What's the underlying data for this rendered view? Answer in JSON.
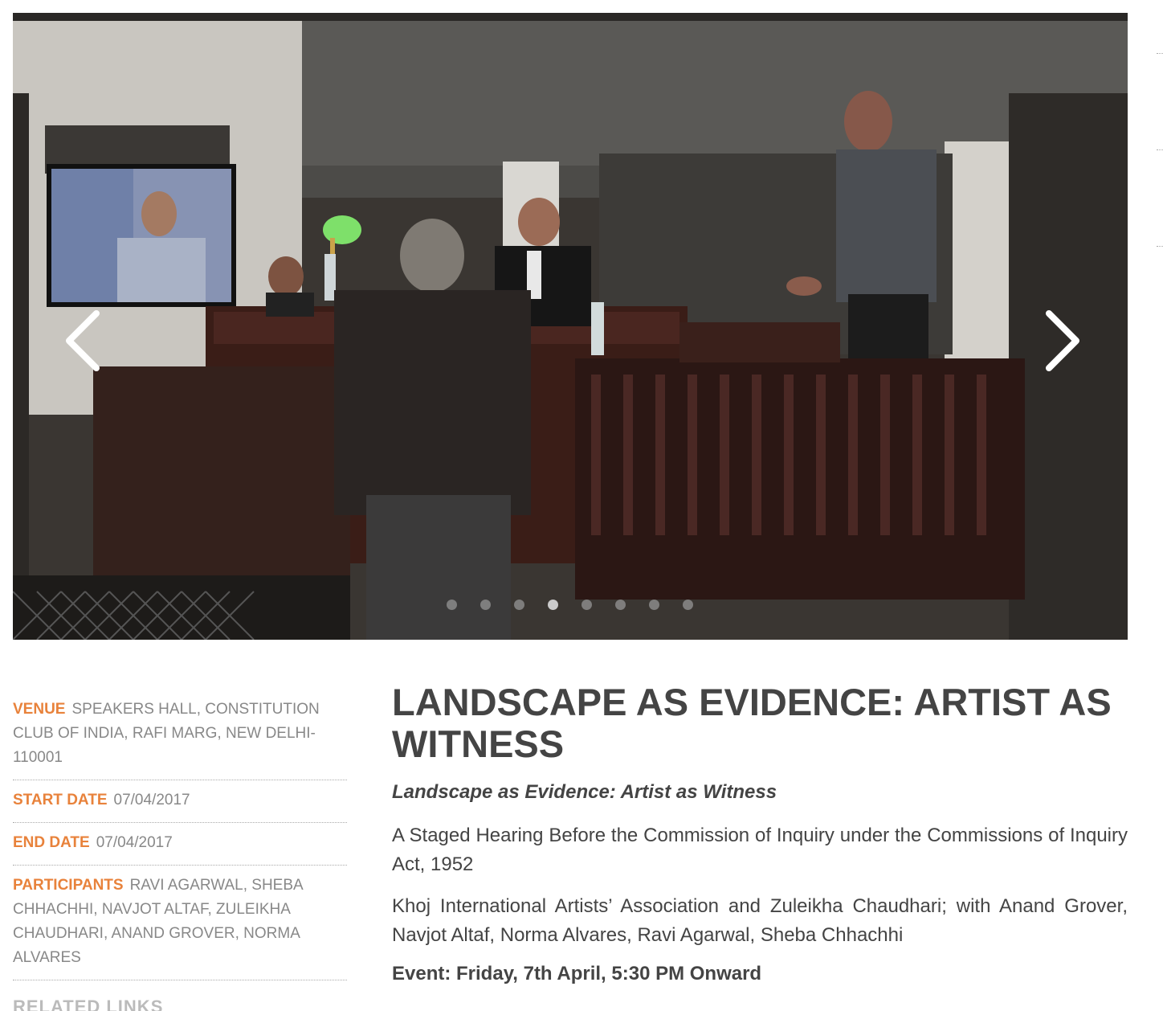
{
  "carousel": {
    "prev_label": "previous-slide",
    "next_label": "next-slide",
    "slide_count": 8,
    "active_index": 3
  },
  "meta": {
    "venue_label": "VENUE",
    "venue_value": "SPEAKERS HALL, CONSTITUTION CLUB OF INDIA, RAFI MARG, NEW DELHI-110001",
    "start_label": "START DATE",
    "start_value": "07/04/2017",
    "end_label": "END DATE",
    "end_value": "07/04/2017",
    "participants_label": "PARTICIPANTS",
    "participants_value": "RAVI AGARWAL, SHEBA CHHACHHI, NAVJOT ALTAF, ZULEIKHA CHAUDHARI, ANAND GROVER, NORMA ALVARES",
    "related_heading": "RELATED LINKS"
  },
  "content": {
    "title": "LANDSCAPE AS EVIDENCE: ARTIST AS WITNESS",
    "subtitle": "Landscape as Evidence: Artist as Witness",
    "para1": "A Staged Hearing Before the Commission of Inquiry under the Commissions of Inquiry Act, 1952",
    "para2": "Khoj International Artists’ Association and Zuleikha Chaudhari; with Anand Grover, Navjot Altaf, Norma Alvares, Ravi Agarwal, Sheba Chhachhi",
    "event": "Event: Friday, 7th April, 5:30 PM Onward"
  },
  "colors": {
    "accent": "#e8823b",
    "text": "#444444",
    "muted": "#888888"
  }
}
